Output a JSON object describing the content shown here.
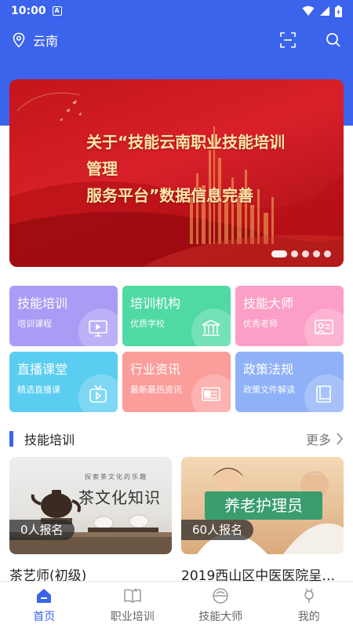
{
  "status_bar": {
    "time": "10:00",
    "a_icon": "A"
  },
  "header": {
    "location": "云南",
    "location_icon": "location-pin-icon",
    "scan_icon": "scan-icon",
    "search_icon": "search-icon"
  },
  "banner": {
    "title_line1": "关于“技能云南职业技能培训管理",
    "title_line2": "服务平台”数据信息完善",
    "dot_count": 5,
    "active_dot": 0
  },
  "tiles": [
    {
      "title": "技能培训",
      "subtitle": "培训课程",
      "icon": "screen-play-icon",
      "color": "#a99cf4"
    },
    {
      "title": "培训机构",
      "subtitle": "优质学校",
      "icon": "building-icon",
      "color": "#4fd9a3"
    },
    {
      "title": "技能大师",
      "subtitle": "优秀老师",
      "icon": "teacher-icon",
      "color": "#fb9fc6"
    },
    {
      "title": "直播课堂",
      "subtitle": "精选直播课",
      "icon": "tv-play-icon",
      "color": "#5bcdf0"
    },
    {
      "title": "行业资讯",
      "subtitle": "最新最热资讯",
      "icon": "news-icon",
      "color": "#fb9e9b"
    },
    {
      "title": "政策法规",
      "subtitle": "政策文件解读",
      "icon": "book-icon",
      "color": "#8fb1f7"
    }
  ],
  "section": {
    "title": "技能培训",
    "more": "更多"
  },
  "courses": [
    {
      "name": "茶艺师(初级)",
      "count": "0人报名",
      "image_caption": "茶文化知识",
      "image_small": "探索茶文化的乐趣"
    },
    {
      "name": "2019西山区中医医院呈…",
      "count": "60人报名",
      "image_caption": "养老护理员"
    }
  ],
  "nav": [
    {
      "label": "首页",
      "icon": "home-icon",
      "active": true
    },
    {
      "label": "职业培训",
      "icon": "open-book-icon",
      "active": false
    },
    {
      "label": "技能大师",
      "icon": "master-icon",
      "active": false
    },
    {
      "label": "我的",
      "icon": "profile-icon",
      "active": false
    }
  ],
  "colors": {
    "primary": "#3b63ec",
    "banner_red": "#c4151b"
  }
}
